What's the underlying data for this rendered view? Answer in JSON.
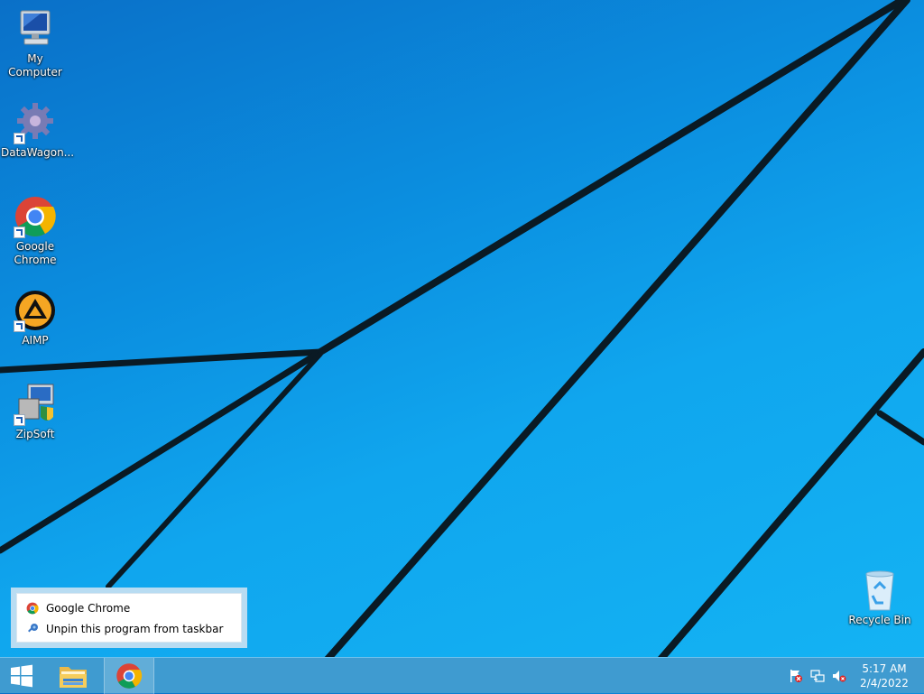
{
  "desktop": {
    "icons": [
      {
        "label": "My Computer",
        "icon": "computer-icon"
      },
      {
        "label": "DataWagon...",
        "icon": "gear-icon"
      },
      {
        "label": "Google Chrome",
        "icon": "chrome-icon"
      },
      {
        "label": "AIMP",
        "icon": "aimp-icon"
      },
      {
        "label": "ZipSoft",
        "icon": "installer-icon"
      },
      {
        "label": "Recycle Bin",
        "icon": "recycle-bin-icon"
      }
    ]
  },
  "jumplist": {
    "items": [
      {
        "label": "Google Chrome",
        "icon": "chrome-icon"
      },
      {
        "label": "Unpin this program from taskbar",
        "icon": "unpin-icon"
      }
    ]
  },
  "taskbar": {
    "buttons": [
      {
        "name": "start",
        "icon": "windows-logo-icon"
      },
      {
        "name": "file-explorer",
        "icon": "folder-icon"
      },
      {
        "name": "google-chrome",
        "icon": "chrome-icon"
      }
    ],
    "tray": {
      "icons": [
        "action-center-flag-icon",
        "network-icon",
        "volume-muted-icon"
      ],
      "time": "5:17 AM",
      "date": "2/4/2022"
    }
  },
  "colors": {
    "wallpaper": "#0b8fe0",
    "taskbar": "#3f9bd0",
    "jumplist_frame": "#b8dcf2"
  }
}
